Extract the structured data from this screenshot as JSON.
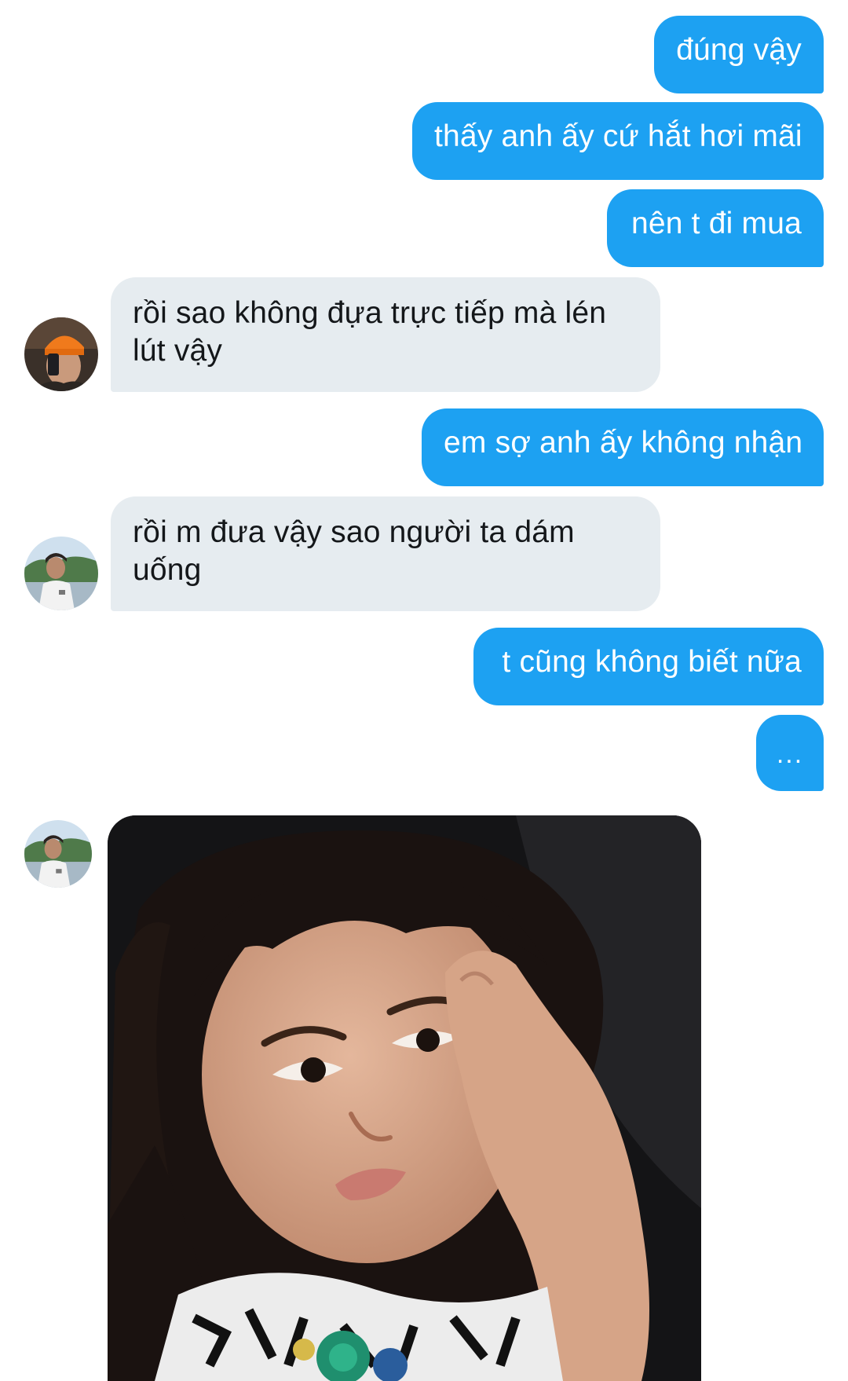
{
  "conversation": {
    "messages": [
      {
        "direction": "outgoing",
        "text": "đúng vậy"
      },
      {
        "direction": "outgoing",
        "text": "thấy anh ấy cứ hắt hơi mãi"
      },
      {
        "direction": "outgoing",
        "text": "nên t đi mua"
      },
      {
        "direction": "incoming",
        "text": "rồi sao không đựa trực tiếp mà lén lút vậy"
      },
      {
        "direction": "outgoing",
        "text": "em sợ anh ấy không nhận"
      },
      {
        "direction": "incoming",
        "text": "rồi m đưa vậy sao người ta dám uống"
      },
      {
        "direction": "outgoing",
        "text": "t cũng không biết nữa"
      },
      {
        "direction": "outgoing",
        "text": "..."
      },
      {
        "direction": "incoming",
        "type": "image",
        "icon": "photo-girl-thinking"
      }
    ]
  },
  "colors": {
    "outgoing_bubble": "#1da1f2",
    "incoming_bubble": "#e6ecf0",
    "background": "#ffffff"
  }
}
